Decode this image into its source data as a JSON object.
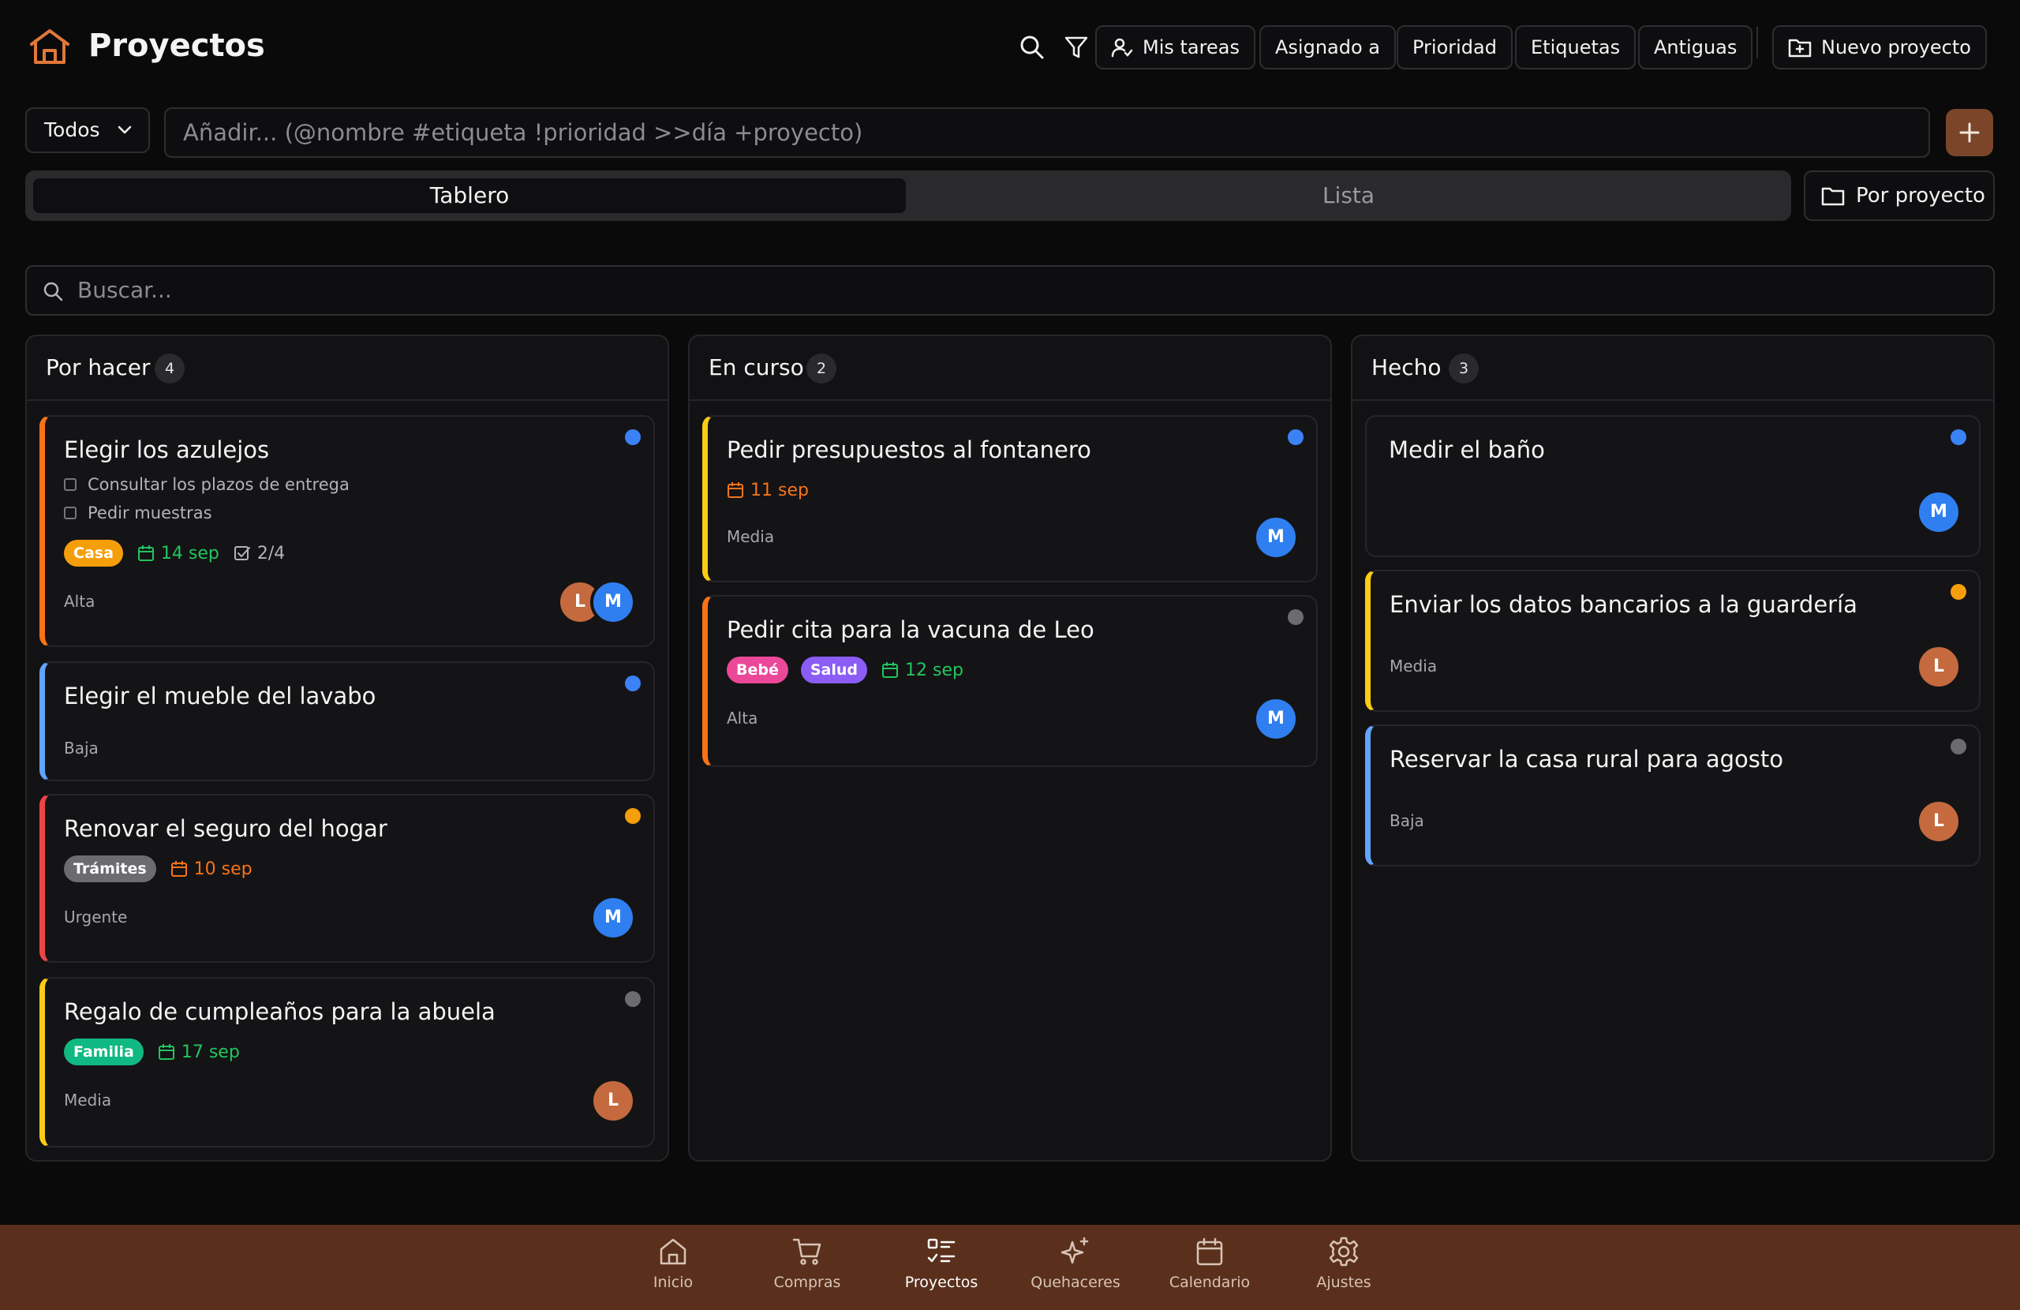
{
  "app": {
    "title": "Proyectos"
  },
  "header": {
    "my_tasks": "Mis tareas",
    "assigned_to": "Asignado a",
    "priority": "Prioridad",
    "tags": "Etiquetas",
    "old": "Antiguas",
    "new_project": "Nuevo proyecto"
  },
  "filter": {
    "scope": "Todos"
  },
  "add": {
    "placeholder": "Añadir... (@nombre #etiqueta !prioridad >>día +proyecto)"
  },
  "view": {
    "board": "Tablero",
    "list": "Lista",
    "group_by": "Por proyecto"
  },
  "search": {
    "placeholder": "Buscar..."
  },
  "colors": {
    "accent": "#7a4528",
    "nav_bg": "#5a301c",
    "dot_blue": "#3b82f6",
    "dot_orange": "#f59e0b",
    "dot_gray": "#6b6b70",
    "border_orange": "#f97316",
    "border_blue": "#60a5fa",
    "border_red": "#ef4444",
    "border_yellow": "#facc15"
  },
  "columns": [
    {
      "title": "Por hacer",
      "count": "4",
      "cards": [
        {
          "title": "Elegir los azulejos",
          "subtasks": [
            "Consultar los plazos de entrega",
            "Pedir muestras"
          ],
          "tag": "Casa",
          "date": "14 sep",
          "progress": "2/4",
          "priority": "Alta",
          "avatars": [
            "L",
            "M"
          ]
        },
        {
          "title": "Elegir el mueble del lavabo",
          "priority": "Baja"
        },
        {
          "title": "Renovar el seguro del hogar",
          "tag": "Trámites",
          "date": "10 sep",
          "priority": "Urgente",
          "avatars": [
            "M"
          ]
        },
        {
          "title": "Regalo de cumpleaños para la abuela",
          "tag": "Familia",
          "date": "17 sep",
          "priority": "Media",
          "avatars": [
            "L"
          ]
        }
      ]
    },
    {
      "title": "En curso",
      "count": "2",
      "cards": [
        {
          "title": "Pedir presupuestos al fontanero",
          "date": "11 sep",
          "priority": "Media",
          "avatars": [
            "M"
          ]
        },
        {
          "title": "Pedir cita para la vacuna de Leo",
          "tags": [
            "Bebé",
            "Salud"
          ],
          "date": "12 sep",
          "priority": "Alta",
          "avatars": [
            "M"
          ]
        }
      ]
    },
    {
      "title": "Hecho",
      "count": "3",
      "cards": [
        {
          "title": "Medir el baño",
          "avatars": [
            "M"
          ]
        },
        {
          "title": "Enviar los datos bancarios a la guardería",
          "priority": "Media",
          "avatars": [
            "L"
          ]
        },
        {
          "title": "Reservar la casa rural para agosto",
          "priority": "Baja",
          "avatars": [
            "L"
          ]
        }
      ]
    }
  ],
  "nav": [
    {
      "label": "Inicio",
      "icon": "home-icon"
    },
    {
      "label": "Compras",
      "icon": "cart-icon"
    },
    {
      "label": "Proyectos",
      "icon": "tasks-icon",
      "active": true
    },
    {
      "label": "Quehaceres",
      "icon": "sparkles-icon"
    },
    {
      "label": "Calendario",
      "icon": "calendar-icon"
    },
    {
      "label": "Ajustes",
      "icon": "gear-icon"
    }
  ]
}
